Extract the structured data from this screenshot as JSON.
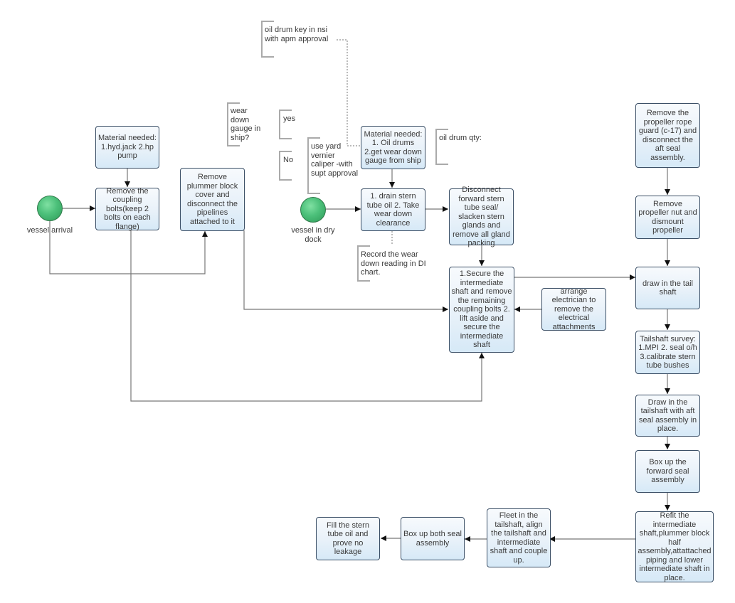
{
  "start_events": {
    "vessel_arrival": "vessel arrival",
    "vessel_dry_dock": "vessel in dry dock"
  },
  "boxes": {
    "material_1": "Material needed: 1.hyd.jack 2.hp pump",
    "remove_coupling": "Remove the coupling bolts(keep 2 bolts on each flange)",
    "remove_plummer": "Remove plummer block cover and disconnect the pipelines attached to it",
    "material_2": "Material needed: 1. Oil drums 2.get wear down gauge from ship",
    "drain_stern": "1. drain stern tube oil 2. Take wear down clearance",
    "disconnect_forward": "Disconnect forward stern tube seal/ slacken stern glands and remove all gland packing",
    "secure_intermediate": "1.Secure the intermediate shaft and remove the remaining coupling bolts 2. lift aside and secure the intermediate shaft",
    "arrange_electrician": "arrange electrician to remove the electrical attachments",
    "remove_rope_guard": "Remove the propeller rope guard (c-17) and disconnect the aft seal assembly.",
    "remove_propeller": "Remove propeller nut and dismount propeller",
    "draw_tail": "draw in the tail shaft",
    "tailshaft_survey": "Tailshaft survey: 1.MPI 2. seal o/h 3.calibrate stern tube bushes",
    "draw_tailshaft_aft": "Draw in the tailshaft with aft seal assembly in place.",
    "box_forward_seal": "Box up the forward seal assembly",
    "refit_intermediate": "Refit the intermediate shaft,plummer block half assembly,attattached piping and lower intermediate shaft in place.",
    "fleet_tailshaft": "Fleet in the tailshaft, align the tailshaft and intermediate shaft and couple up.",
    "box_both_seal": "Box up both seal assembly",
    "fill_stern": "Fill the stern tube oil and prove no leakage"
  },
  "annotations": {
    "oil_drum_key": "oil drum key in nsi\nwith apm approval",
    "wear_gauge_q": "wear\ndown\ngauge in\nship?",
    "yes": "yes",
    "no": "No",
    "yard_vernier": "use yard\nvernier\ncaliper -with\nsupt approval",
    "oil_drum_qty": "oil drum qty:",
    "record_wear": "Record the wear\ndown reading in DI\nchart."
  },
  "colors": {
    "box_border": "#3b4f66",
    "box_fill_top": "#f7fafd",
    "box_fill_bottom": "#d6e9f7",
    "start_green": "#4cc07a",
    "connector": "#777777",
    "annotation_bracket": "#aaaaaa"
  }
}
